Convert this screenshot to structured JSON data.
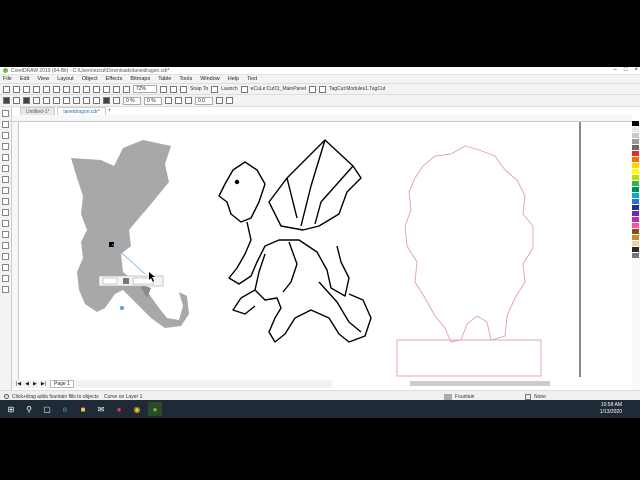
{
  "window": {
    "title": "CorelDRAW 2019 (64-Bit) - C:\\Users\\ezcut\\Downloads\\laneidragon.cdr*"
  },
  "menubar": [
    "File",
    "Edit",
    "View",
    "Layout",
    "Object",
    "Effects",
    "Bitmaps",
    "Table",
    "Tools",
    "Window",
    "Help",
    "Text"
  ],
  "toolbar": {
    "zoom": "72%",
    "snap_label": "Snap To",
    "launch_label": "Launch",
    "panel1": "eCuLe:CutCt_MainPanel",
    "panel2": "TagCut:Modules1.TagCut"
  },
  "propertybar": {
    "rotation": "0 %",
    "rotation2": "0 %",
    "outline": "0.0"
  },
  "tabs": [
    {
      "label": "Untitled-1*"
    },
    {
      "label": "laneidragon.cdr*"
    }
  ],
  "pagebar": {
    "page_label": "Page 1"
  },
  "status": {
    "hint": "Click+drag adds fountain fills to objects",
    "layer": "Curve on Layer 1",
    "fill_label": "Fountain",
    "outline_label": "None"
  },
  "tray": {
    "time": "10:58 AM",
    "date": "1/13/2020"
  },
  "palette": [
    "#ffffff",
    "#000000",
    "#e8e8e8",
    "#c8c8c8",
    "#9a9a9a",
    "#6a6a6a",
    "#e32b2b",
    "#ff6a00",
    "#ffd400",
    "#ffff00",
    "#b9e000",
    "#2bb84a",
    "#008a5c",
    "#00b2c7",
    "#2b6fe6",
    "#1a2fa0",
    "#6a2ab8",
    "#c02bb8",
    "#ff4fa1",
    "#8a4a1a",
    "#c4883c",
    "#f4d0a0",
    "#2a2a2a",
    "#777777"
  ]
}
